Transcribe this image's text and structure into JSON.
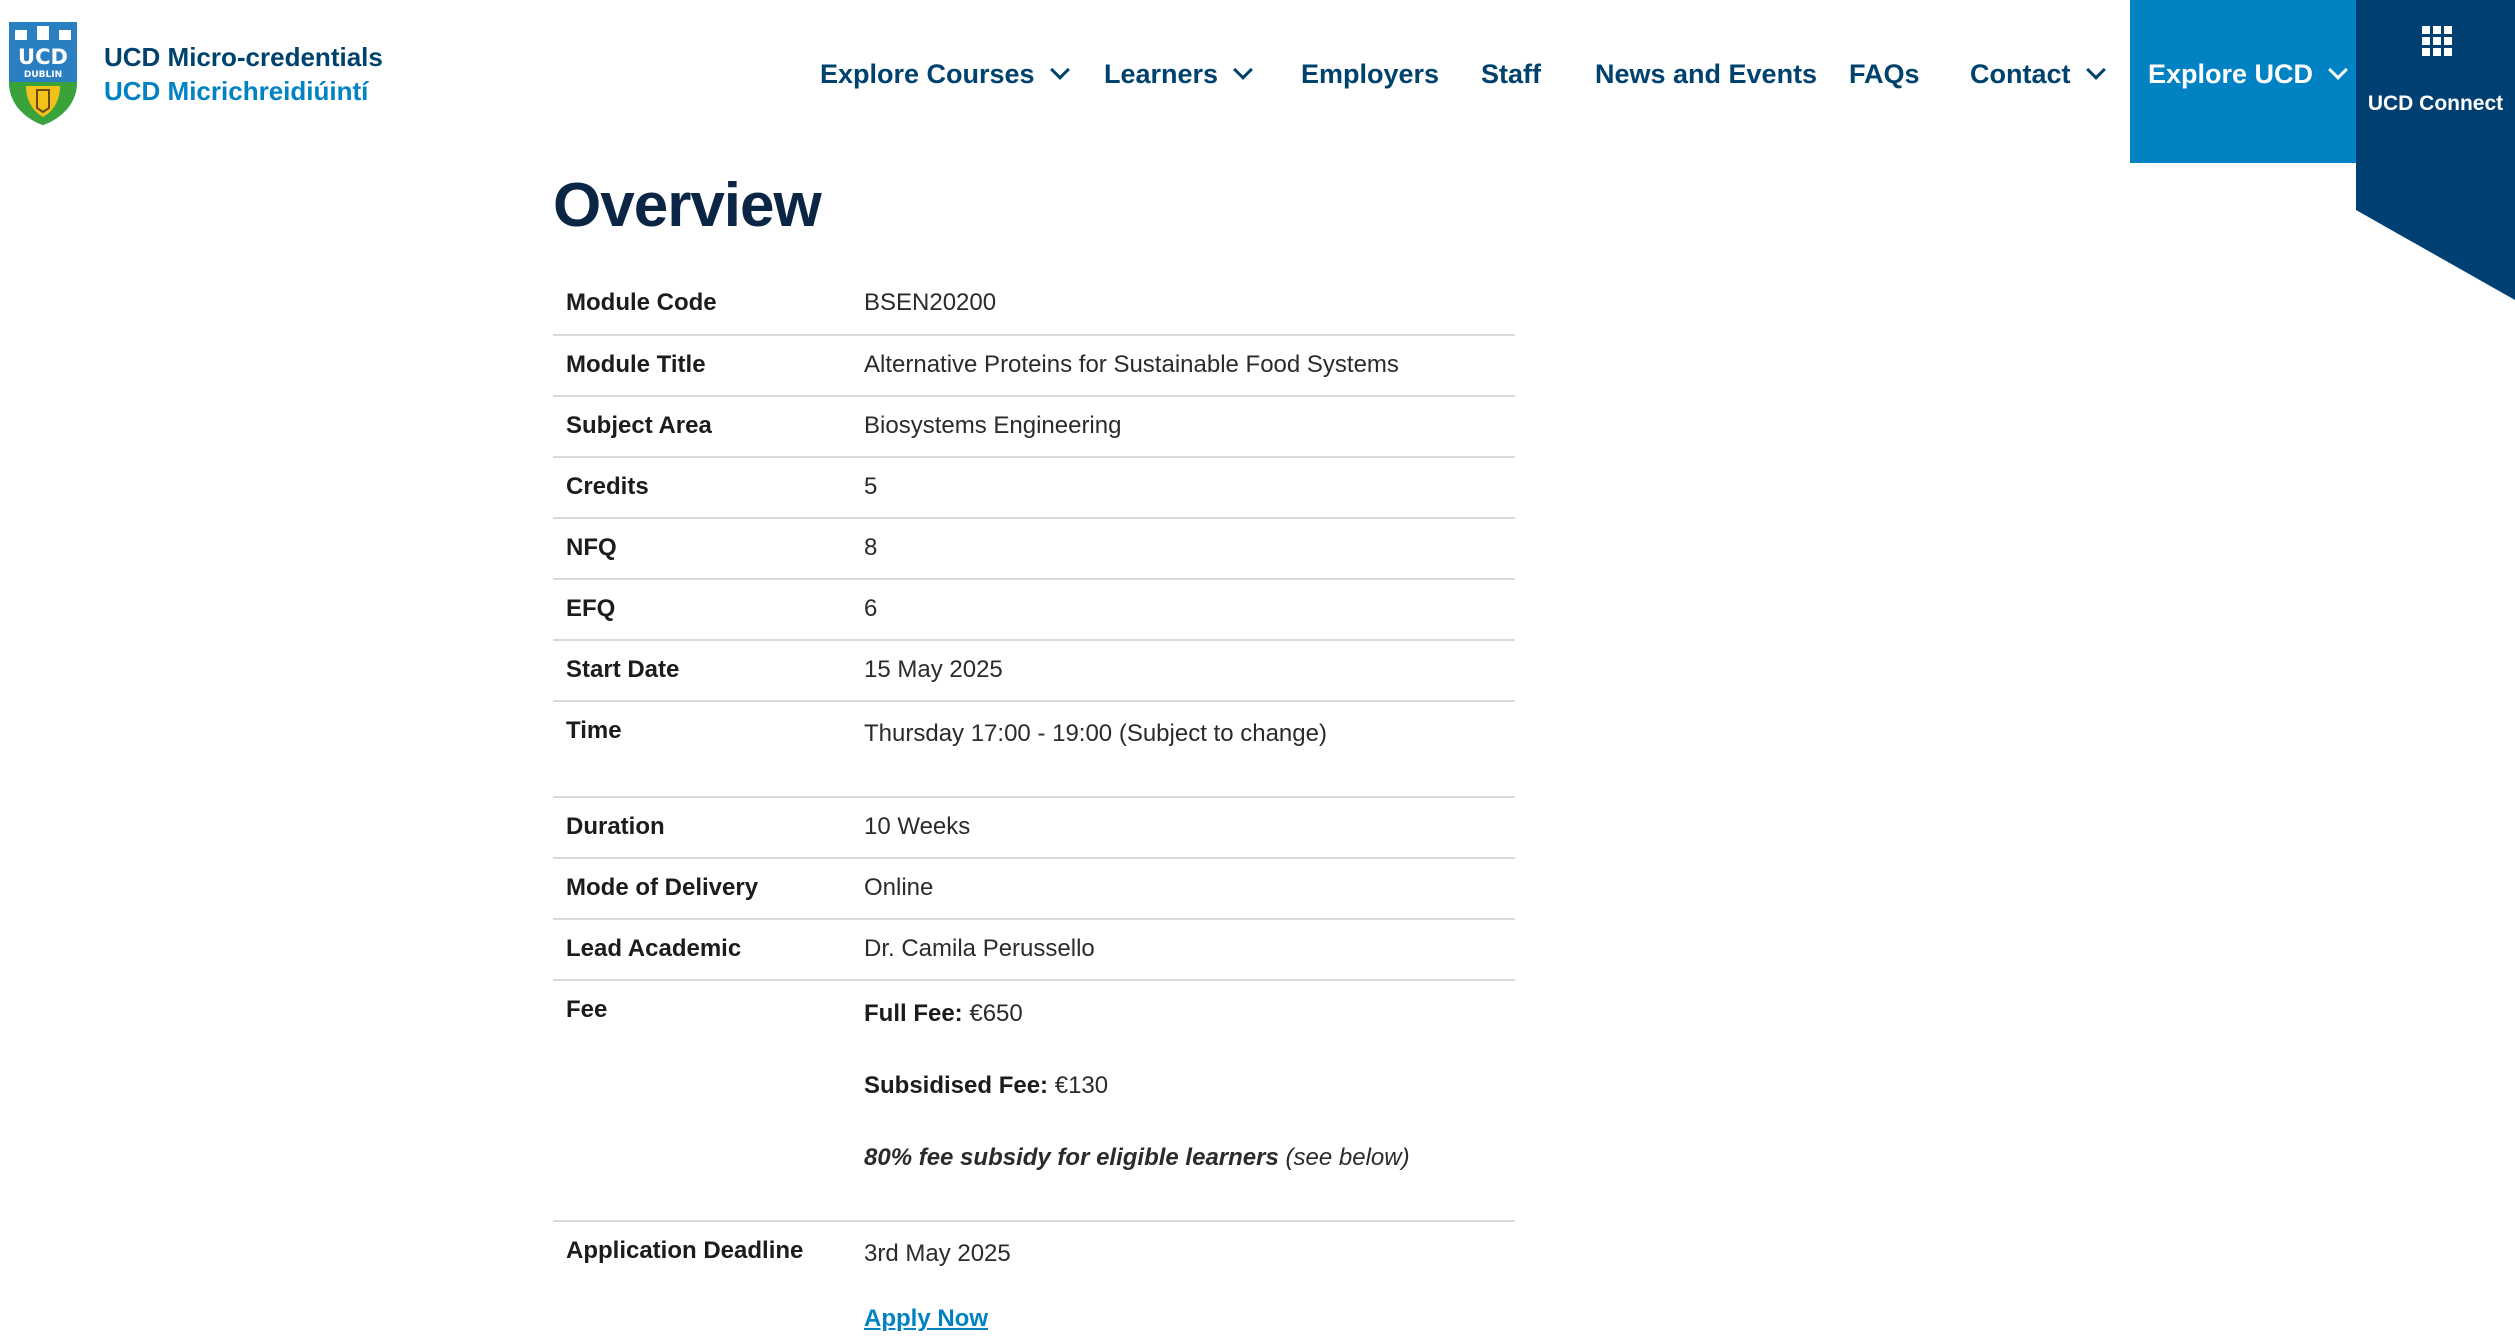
{
  "brand": {
    "line1": "UCD Micro-credentials",
    "line2": "UCD Micrichreidiúintí",
    "logo_text_top": "UCD",
    "logo_text_bottom": "DUBLIN"
  },
  "nav": {
    "items": [
      {
        "label": "Explore Courses",
        "has_dropdown": true
      },
      {
        "label": "Learners",
        "has_dropdown": true
      },
      {
        "label": "Employers",
        "has_dropdown": false
      },
      {
        "label": "Staff",
        "has_dropdown": false
      },
      {
        "label": "News and Events",
        "has_dropdown": false
      },
      {
        "label": "FAQs",
        "has_dropdown": false
      },
      {
        "label": "Contact",
        "has_dropdown": true
      }
    ],
    "explore_ucd": "Explore UCD",
    "ucd_connect": "UCD Connect"
  },
  "colors": {
    "navy": "#00426e",
    "blue": "#0082c3",
    "dark_navy": "#003f72",
    "title": "#0b2545",
    "divider": "#d9d9d9"
  },
  "overview": {
    "title": "Overview",
    "rows": [
      {
        "label": "Module Code",
        "value": "BSEN20200"
      },
      {
        "label": "Module Title",
        "value": "Alternative Proteins for Sustainable Food Systems"
      },
      {
        "label": "Subject Area",
        "value": "Biosystems Engineering"
      },
      {
        "label": "Credits",
        "value": "5"
      },
      {
        "label": "NFQ",
        "value": "8"
      },
      {
        "label": "EFQ",
        "value": "6"
      },
      {
        "label": "Start Date",
        "value": "15 May 2025"
      },
      {
        "label": "Time",
        "value": "Thursday 17:00 - 19:00 (Subject to change)"
      },
      {
        "label": "Duration",
        "value": "10 Weeks"
      },
      {
        "label": "Mode of Delivery",
        "value": "Online"
      },
      {
        "label": "Lead Academic",
        "value": "Dr. Camila Perussello"
      }
    ],
    "fee": {
      "label": "Fee",
      "full_label": "Full Fee:",
      "full_value": "€650",
      "subsidised_label": "Subsidised Fee:",
      "subsidised_value": "€130",
      "note_bold": "80% fee subsidy for eligible learners",
      "note_rest": "(see below)"
    },
    "deadline": {
      "label": "Application Deadline",
      "value": "3rd May 2025",
      "apply_label": "Apply Now"
    }
  }
}
